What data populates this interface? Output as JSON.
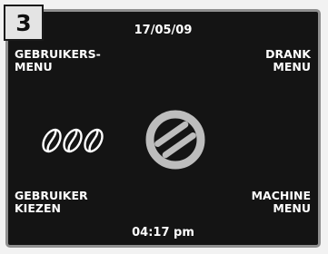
{
  "step_number": "3",
  "date": "17/05/09",
  "time": "04:17 pm",
  "menus": {
    "top_left": {
      "line1": "GEBRUIKERS-",
      "line2": "MENU"
    },
    "top_right": {
      "line1": "DRANK",
      "line2": "MENU"
    },
    "bottom_left": {
      "line1": "GEBRUIKER",
      "line2": "KIEZEN"
    },
    "bottom_right": {
      "line1": "MACHINE",
      "line2": "MENU"
    }
  },
  "icons": {
    "beans": "coffee-beans-icon",
    "logo": "brand-logo-icon"
  },
  "colors": {
    "screen_background": "#141414",
    "text": "#ffffff",
    "badge_background": "#e4e4e4",
    "logo_gray": "#bdbdbd"
  }
}
